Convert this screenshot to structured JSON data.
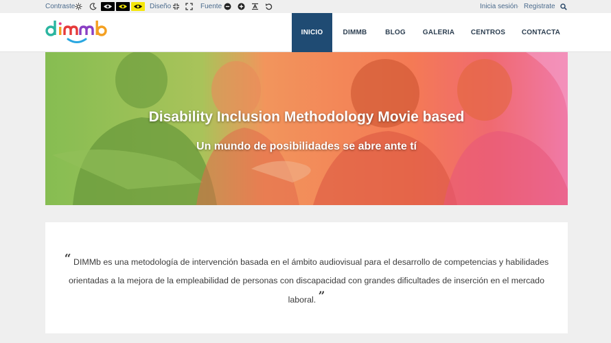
{
  "topbar": {
    "contrast_label": "Contraste",
    "design_label": "Diseño",
    "font_label": "Fuente",
    "login_link": "Inicia sesión",
    "register_link": "Registrate"
  },
  "nav": {
    "items": [
      "INICIO",
      "DIMMB",
      "BLOG",
      "GALERIA",
      "CENTROS",
      "CONTACTA"
    ],
    "active": "INICIO"
  },
  "logo": {
    "text": "dimmb"
  },
  "hero": {
    "title": "Disability Inclusion Methodology Movie based",
    "subtitle": "Un mundo de posibilidades se abre ante tí"
  },
  "quote": {
    "open_mark": "“",
    "text": "DIMMb es una metodología de intervención basada en el ámbito audiovisual para el desarrollo de competencias y habilidades orientadas a la mejora de la empleabilidad de personas con discapacidad con grandes dificultades de inserción en el mercado laboral.",
    "close_mark": "”"
  },
  "colors": {
    "nav_active_bg": "#1f4b73",
    "link": "#4a6a8c",
    "hero_green": "#8fc456",
    "hero_orange": "#f08a5d",
    "hero_pink": "#ee5a86"
  }
}
